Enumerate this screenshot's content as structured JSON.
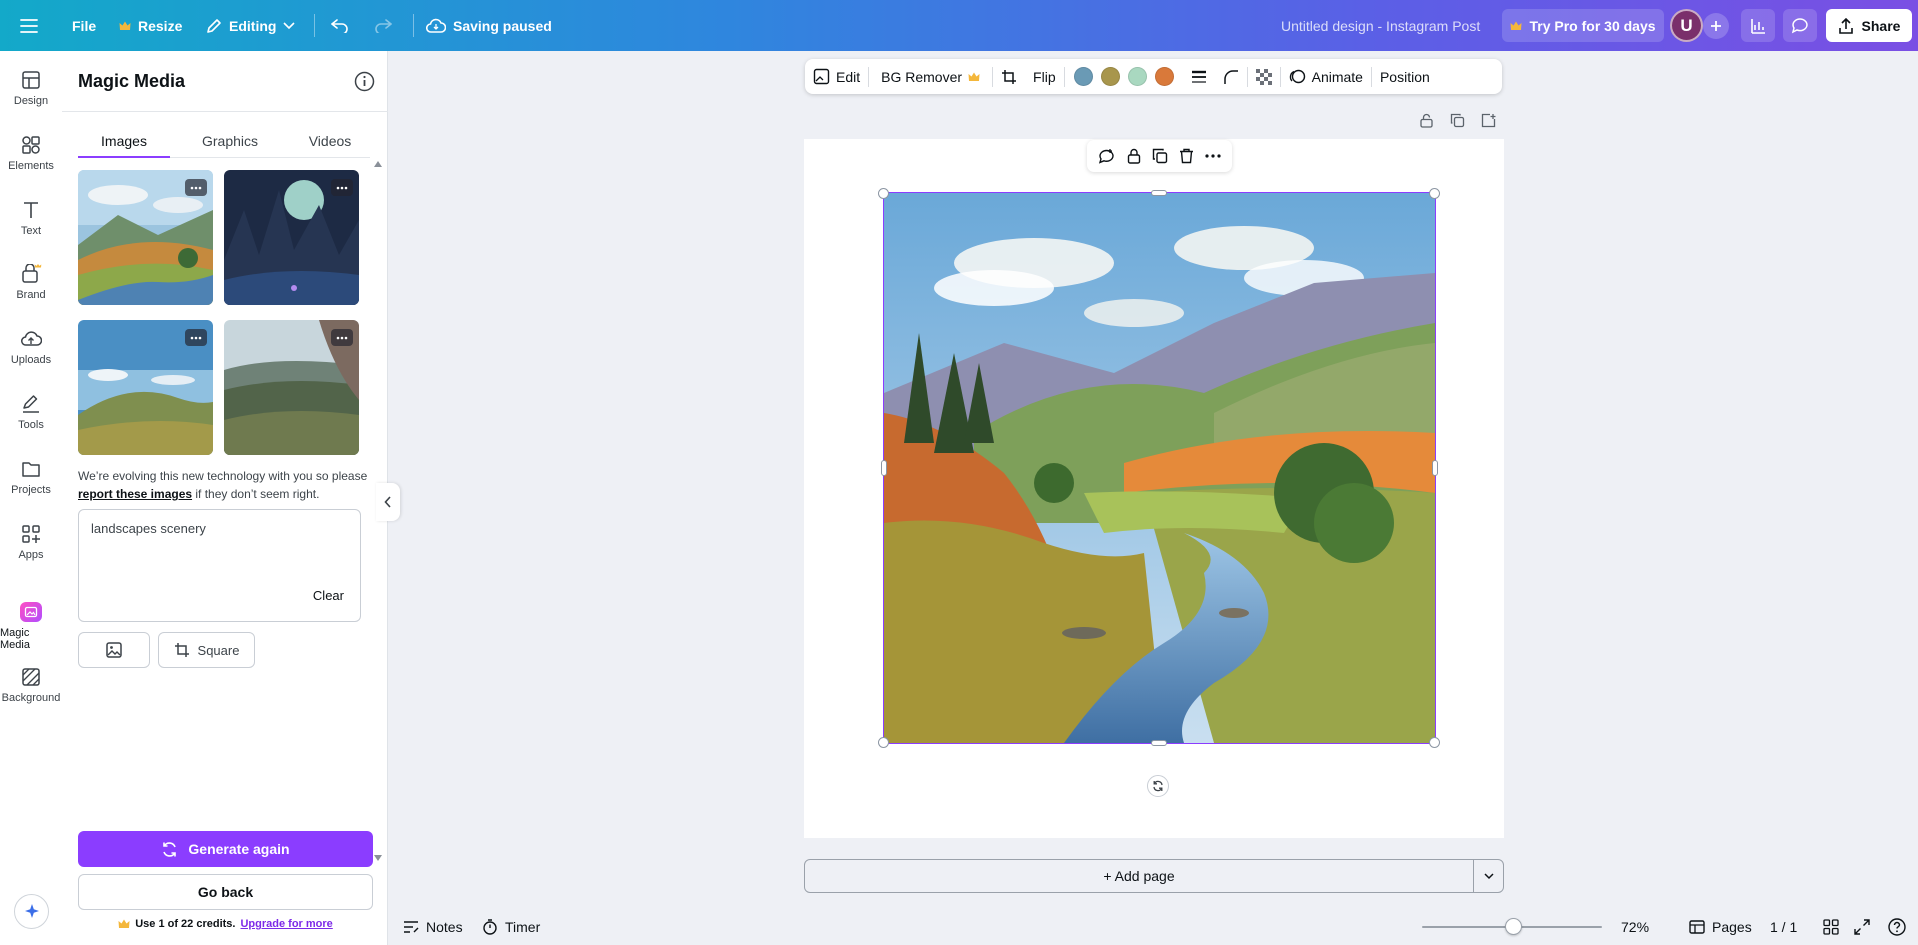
{
  "topbar": {
    "file_label": "File",
    "resize_label": "Resize",
    "editing_label": "Editing",
    "saving_status": "Saving paused",
    "design_title": "Untitled design - Instagram Post",
    "try_pro_label": "Try Pro for 30 days",
    "avatar_initial": "U",
    "share_label": "Share",
    "gradient_start": "#13a9c9",
    "gradient_end": "#7a4fe4"
  },
  "rail": {
    "items": [
      {
        "label": "Design",
        "icon": "layout-icon"
      },
      {
        "label": "Elements",
        "icon": "shapes-icon"
      },
      {
        "label": "Text",
        "icon": "text-icon"
      },
      {
        "label": "Brand",
        "icon": "brand-icon"
      },
      {
        "label": "Uploads",
        "icon": "cloud-upload-icon"
      },
      {
        "label": "Tools",
        "icon": "pen-icon"
      },
      {
        "label": "Projects",
        "icon": "folder-icon"
      },
      {
        "label": "Apps",
        "icon": "apps-icon"
      },
      {
        "label": "Magic Media",
        "icon": "magic-media-icon"
      },
      {
        "label": "Background",
        "icon": "background-icon"
      }
    ]
  },
  "panel": {
    "title": "Magic Media",
    "tabs": [
      {
        "label": "Images",
        "active": true
      },
      {
        "label": "Graphics",
        "active": false
      },
      {
        "label": "Videos",
        "active": false
      }
    ],
    "disclaimer_pre": "We’re evolving this new technology with you so please ",
    "disclaimer_link": "report these images",
    "disclaimer_post": " if they don’t seem right.",
    "prompt_value": "landscapes scenery",
    "clear_label": "Clear",
    "aspect_label": "Square",
    "generate_label": "Generate again",
    "go_back_label": "Go back",
    "credits_text": "Use 1 of 22 credits.",
    "upgrade_link": "Upgrade for more",
    "accent_color": "#8b3dff"
  },
  "context_toolbar": {
    "edit_label": "Edit",
    "bg_remover_label": "BG Remover",
    "flip_label": "Flip",
    "swatches": [
      "#6a9ab5",
      "#a8964c",
      "#a9d8c0",
      "#d9793a"
    ],
    "animate_label": "Animate",
    "position_label": "Position"
  },
  "canvas": {
    "add_page_label": "+ Add page"
  },
  "bottombar": {
    "notes_label": "Notes",
    "timer_label": "Timer",
    "zoom_percent": 72,
    "zoom_label": "72%",
    "pages_label": "Pages",
    "page_count": "1 / 1"
  }
}
